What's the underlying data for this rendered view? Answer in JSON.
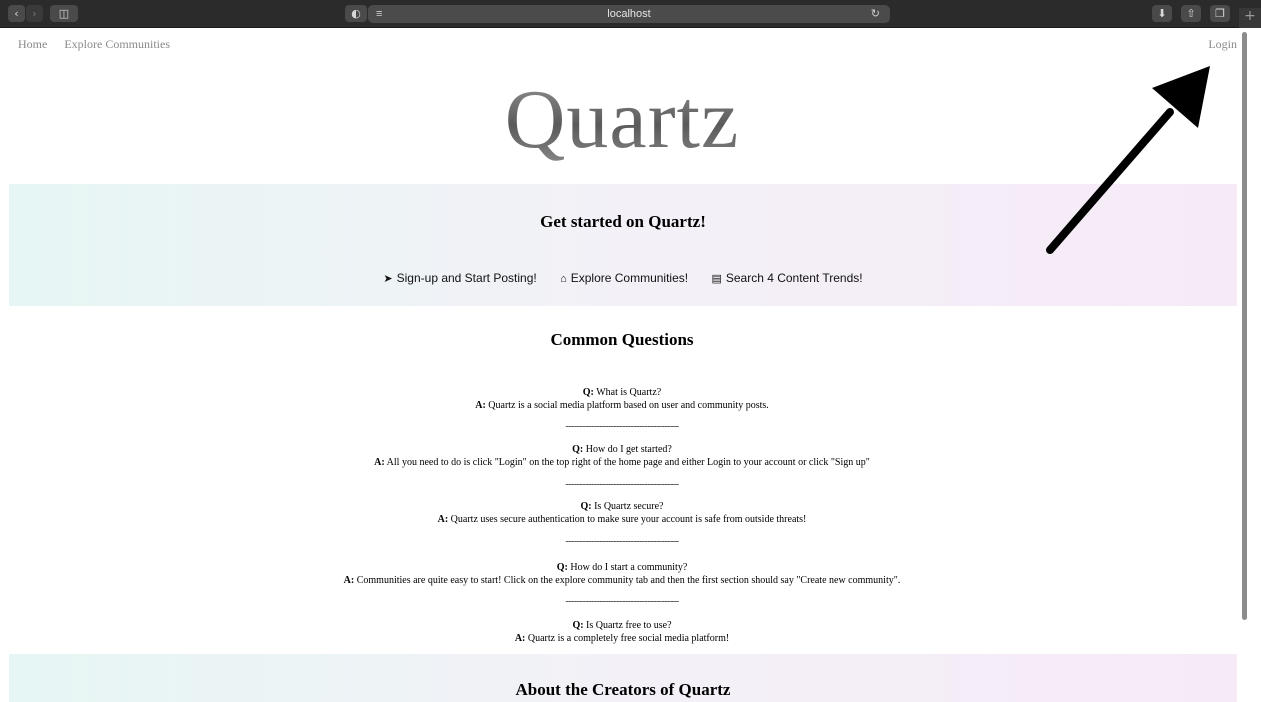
{
  "browser": {
    "url": "localhost",
    "back_icon": "chevron-left-icon",
    "forward_icon": "chevron-right-icon",
    "sidebar_icon": "sidebar-icon",
    "reload_icon": "reload-icon",
    "download_icon": "download-icon",
    "share_icon": "share-icon",
    "tabs_icon": "tabs-icon",
    "new_tab_label": "+"
  },
  "nav": {
    "home": "Home",
    "explore": "Explore Communities",
    "login": "Login"
  },
  "logo": "Quartz",
  "get_started": {
    "title": "Get started on Quartz!",
    "links": [
      {
        "icon": "paper-plane-icon",
        "label": "Sign-up and Start Posting!"
      },
      {
        "icon": "home-icon",
        "label": "Explore Communities!"
      },
      {
        "icon": "newspaper-icon",
        "label": "Search 4 Content Trends!"
      }
    ]
  },
  "faq": {
    "title": "Common Questions",
    "q_prefix": "Q:",
    "a_prefix": "A:",
    "separator": "----------------------------------------",
    "items": [
      {
        "q": "What is Quartz?",
        "a": "Quartz is a social media platform based on user and community posts."
      },
      {
        "q": "How do I get started?",
        "a": "All you need to do is click \"Login\" on the top right of the home page and either Login to your account or click \"Sign up\""
      },
      {
        "q": "Is Quartz secure?",
        "a": "Quartz uses secure authentication to make sure your account is safe from outside threats!"
      },
      {
        "q": "How do I start a community?",
        "a": "Communities are quite easy to start! Click on the explore community tab and then the first section should say \"Create new community\"."
      },
      {
        "q": "Is Quartz free to use?",
        "a": "Quartz is a completely free social media platform!"
      }
    ]
  },
  "about": {
    "title": "About the Creators of Quartz"
  },
  "annotation": {
    "icon": "pointer-arrow-icon",
    "color": "#000000"
  }
}
